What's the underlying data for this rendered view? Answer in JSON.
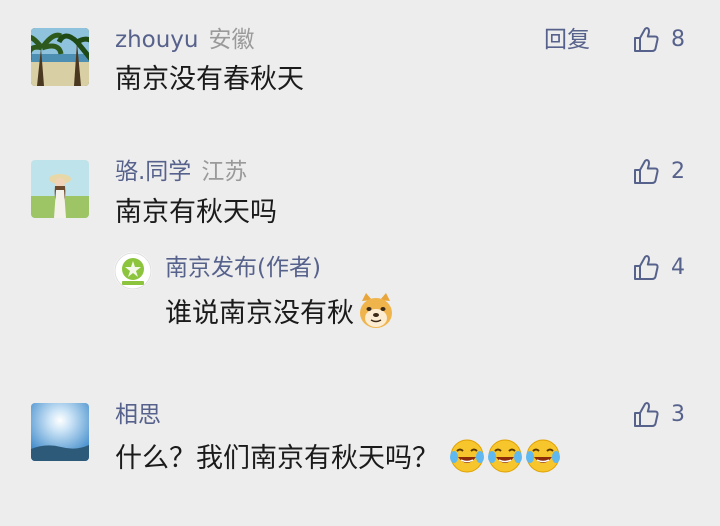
{
  "comments": [
    {
      "name": "zhouyu",
      "region": "安徽",
      "text": "南京没有春秋天",
      "reply_label": "回复",
      "likes": "8",
      "avatar_icon": "palm-beach-avatar"
    },
    {
      "name": "骆.同学",
      "region": "江苏",
      "text": "南京有秋天吗",
      "likes": "2",
      "avatar_icon": "girl-in-field-avatar",
      "reply": {
        "name": "南京发布(作者)",
        "text": "谁说南京没有秋",
        "likes": "4",
        "avatar_icon": "nanjing-fabu-logo",
        "emoji": "doge-emoji"
      }
    },
    {
      "name": "相思",
      "text": "什么？我们南京有秋天吗？",
      "likes": "3",
      "avatar_icon": "sky-sun-avatar",
      "emojis": [
        "laugh-cry-emoji",
        "laugh-cry-emoji",
        "laugh-cry-emoji"
      ]
    }
  ],
  "colors": {
    "background": "#ededed",
    "name": "#57628c",
    "region": "#9a9a9a",
    "text": "#1b1b1b"
  }
}
